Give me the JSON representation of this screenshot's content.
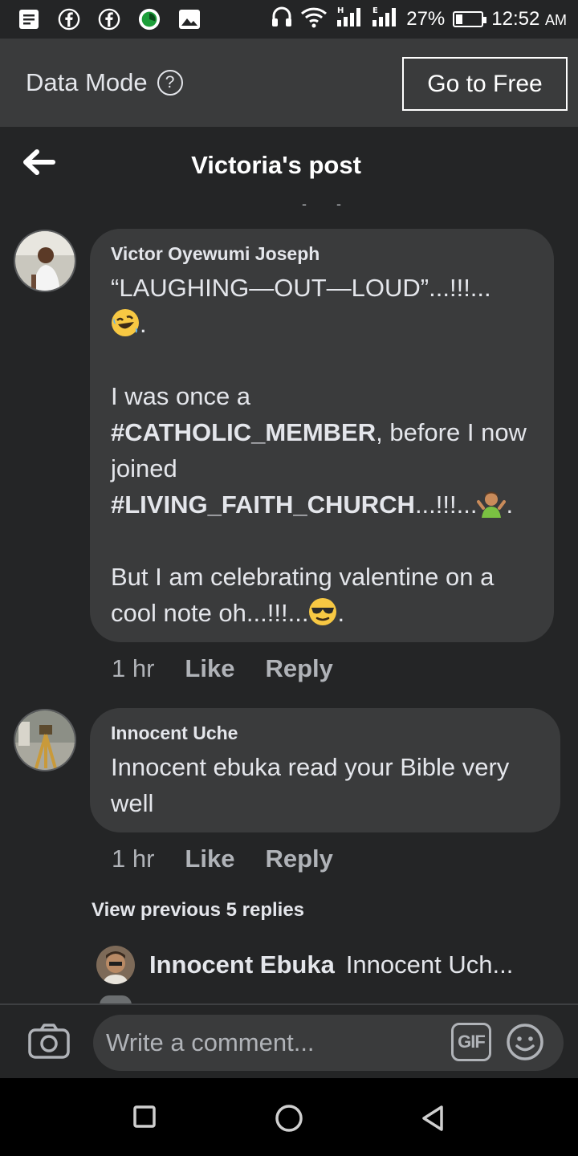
{
  "status_bar": {
    "battery": "27%",
    "time": "12:52",
    "ampm": "AM",
    "battery_level": 0.27,
    "icons": [
      "notes-icon",
      "facebook-icon",
      "facebook-icon",
      "data-saver-icon",
      "gallery-icon",
      "headphones-icon",
      "wifi-icon",
      "signal-h-icon",
      "signal-e-icon"
    ]
  },
  "data_mode": {
    "label": "Data Mode",
    "help_symbol": "?",
    "go_free_label": "Go to Free"
  },
  "header": {
    "title": "Victoria's post",
    "dashes": "- -"
  },
  "comments": [
    {
      "author": "Victor Oyewumi Joseph",
      "text": {
        "l1": "“LAUGHING—OUT—LOUD”...!!!...",
        "l1b": ".",
        "l2a": "I was once a",
        "l2b": "#CATHOLIC_MEMBER",
        "l2c": ", before I now joined",
        "l2d": "#LIVING_FAITH_CHURCH",
        "l2e": "...!!!...",
        "l2f": ".",
        "l3a": "But I am celebrating valentine on a cool note oh...!!!...",
        "l3b": "."
      },
      "emojis": [
        "rolling-laughing-emoji",
        "shrug-emoji",
        "sunglasses-emoji"
      ],
      "time": "1 hr",
      "like": "Like",
      "reply": "Reply"
    },
    {
      "author": "Innocent Uche",
      "text": "Innocent ebuka read your Bible very well",
      "time": "1 hr",
      "like": "Like",
      "reply": "Reply"
    }
  ],
  "view_previous": "View previous 5 replies",
  "reply_preview": {
    "name": "Innocent Ebuka",
    "snippet": "Innocent Uch..."
  },
  "composer": {
    "placeholder": "Write a comment...",
    "gif_label": "GIF"
  },
  "colors": {
    "background": "#242526",
    "bubble": "#3a3b3c",
    "text": "#e4e6eb",
    "secondary": "#b0b3b8"
  }
}
